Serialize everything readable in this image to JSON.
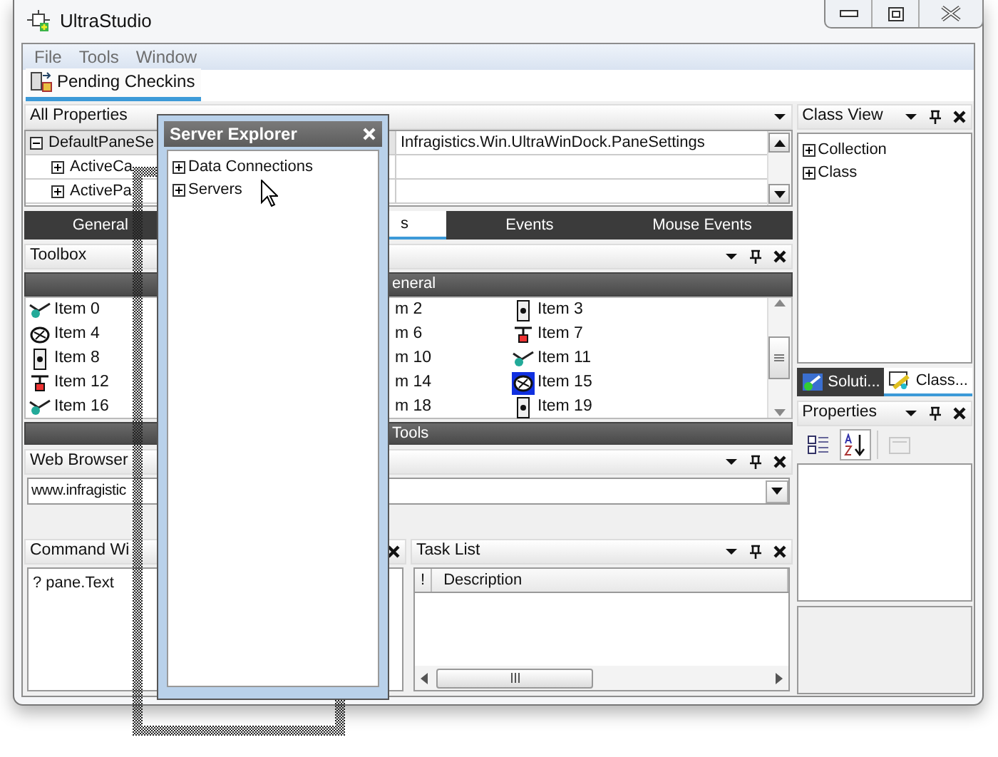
{
  "window": {
    "title": "UltraStudio"
  },
  "menu": [
    {
      "label": "File"
    },
    {
      "label": "Tools"
    },
    {
      "label": "Window"
    }
  ],
  "toolbar_tabs": [
    {
      "label": "Pending Checkins",
      "selected": true
    }
  ],
  "all_properties": {
    "title": "All Properties",
    "rows": [
      {
        "name": "DefaultPaneSe",
        "value": "Infragistics.Win.UltraWinDock.PaneSettings",
        "expanded": true,
        "kind": "category"
      },
      {
        "name": "ActiveCa",
        "expanded": false,
        "kind": "property"
      },
      {
        "name": "ActivePa",
        "expanded": false,
        "kind": "property"
      }
    ],
    "tabs": [
      {
        "label": "General",
        "selected": false
      },
      {
        "label": "s",
        "selected": true
      },
      {
        "label": "Events",
        "selected": false
      },
      {
        "label": "Mouse Events",
        "selected": false
      }
    ]
  },
  "toolbox": {
    "title": "Toolbox",
    "groups": [
      {
        "label": "eneral",
        "columns": [
          {
            "covered": false,
            "items": [
              "Item 0",
              "Item 4",
              "Item 8",
              "Item 12",
              "Item 16"
            ]
          },
          {
            "covered": true,
            "items": [
              "m 2",
              "m 6",
              "m 10",
              "m 14",
              "m 18"
            ]
          },
          {
            "covered": false,
            "items": [
              "Item 3",
              "Item 7",
              "Item 11",
              "Item 15",
              "Item 19"
            ]
          }
        ]
      },
      {
        "label": "Tools"
      }
    ]
  },
  "web_browser": {
    "title": "Web Browser",
    "address": "www.infragistic"
  },
  "command_window": {
    "title": "Command Wi",
    "lines": [
      "? pane.Text"
    ]
  },
  "task_list": {
    "title": "Task List",
    "columns": [
      "!",
      "Description"
    ]
  },
  "class_view": {
    "title": "Class View",
    "tree": [
      {
        "label": "Collection",
        "expanded": false
      },
      {
        "label": "Class",
        "expanded": false
      }
    ]
  },
  "side_tabs": [
    {
      "label": "Soluti...",
      "selected": false
    },
    {
      "label": "Class...",
      "selected": true
    }
  ],
  "properties": {
    "title": "Properties",
    "tools": [
      {
        "kind": "categorized",
        "selected": false,
        "disabled": false
      },
      {
        "kind": "alphabetical",
        "selected": true,
        "disabled": false
      },
      {
        "kind": "pages",
        "selected": false,
        "disabled": true
      }
    ]
  },
  "server_explorer": {
    "title": "Server Explorer",
    "tree": [
      {
        "label": "Data Connections",
        "expanded": false
      },
      {
        "label": "Servers",
        "expanded": false
      }
    ]
  }
}
